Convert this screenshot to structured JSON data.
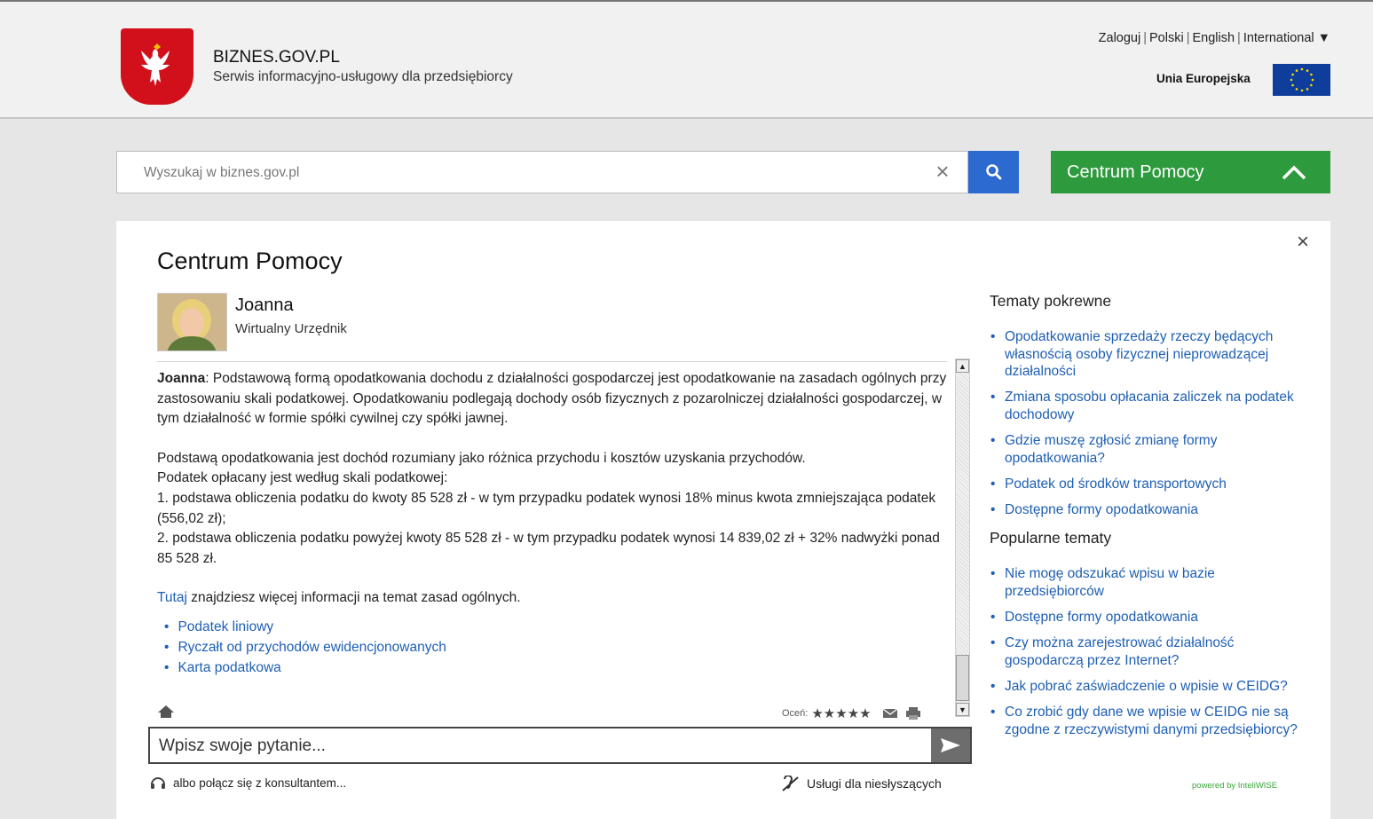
{
  "header": {
    "brand_title": "BIZNES.GOV.PL",
    "brand_subtitle": "Serwis informacyjno-usługowy dla przedsiębiorcy",
    "nav": [
      "Zaloguj",
      "Polski",
      "English",
      "International ▼"
    ],
    "eu_label": "Unia Europejska"
  },
  "search": {
    "placeholder": "Wyszukaj w biznes.gov.pl",
    "clear_icon": "×"
  },
  "help_button": {
    "label": "Centrum Pomocy"
  },
  "panel": {
    "title": "Centrum Pomocy",
    "close_icon": "×",
    "agent": {
      "name": "Joanna",
      "role": "Wirtualny Urzędnik"
    },
    "message": {
      "speaker": "Joanna",
      "intro": ": Podstawową formą opodatkowania dochodu z działalności gospodarczej jest opodatkowanie na zasadach ogólnych przy zastosowaniu skali podatkowej. Opodatkowaniu podlegają dochody osób fizycznych z pozarolniczej działalności gospodarczej, w tym działalność w formie spółki cywilnej czy spółki jawnej.",
      "line1": "Podstawą opodatkowania jest dochód rozumiany jako różnica przychodu i kosztów uzyskania przychodów.",
      "line2": "Podatek opłacany jest według skali podatkowej:",
      "line3": "1. podstawa obliczenia podatku do kwoty 85 528 zł - w tym przypadku podatek wynosi 18% minus kwota zmniejszająca podatek (556,02 zł);",
      "line4": "2. podstawa obliczenia podatku powyżej kwoty 85 528 zł - w tym przypadku podatek wynosi 14 839,02 zł + 32% nadwyżki ponad 85 528 zł.",
      "more_link": "Tutaj",
      "more_text": " znajdziesz więcej informacji na temat zasad ogólnych.",
      "links": [
        "Podatek liniowy",
        "Ryczałt od przychodów ewidencjonowanych",
        "Karta podatkowa"
      ]
    },
    "rating_label": "Oceń:",
    "rating_stars": "★★★★★",
    "ask_placeholder": "Wpisz swoje pytanie...",
    "consult_text": "albo połącz się z konsultantem...",
    "deaf_text": "Usługi dla niesłyszących",
    "powered_by": "powered by InteliWISE"
  },
  "sidebar": {
    "related_title": "Tematy pokrewne",
    "related": [
      "Opodatkowanie sprzedaży rzeczy będących własnością osoby fizycznej nieprowadzącej działalności",
      "Zmiana sposobu opłacania zaliczek na podatek dochodowy",
      "Gdzie muszę zgłosić zmianę formy opodatkowania?",
      "Podatek od środków transportowych",
      "Dostępne formy opodatkowania"
    ],
    "popular_title": "Popularne tematy",
    "popular": [
      "Nie mogę odszukać wpisu w bazie przedsiębiorców",
      "Dostępne formy opodatkowania",
      "Czy można zarejestrować działalność gospodarczą przez Internet?",
      "Jak pobrać zaświadczenie o wpisie w CEIDG?",
      "Co zrobić gdy dane we wpisie w CEIDG nie są zgodne z rzeczywistymi danymi przedsiębiorcy?"
    ]
  },
  "colors": {
    "search_button": "#2c6ad0",
    "help_button": "#2e9a3e",
    "link": "#1e5fb4",
    "emblem": "#d1101c",
    "eu_flag": "#0e3d9b"
  }
}
